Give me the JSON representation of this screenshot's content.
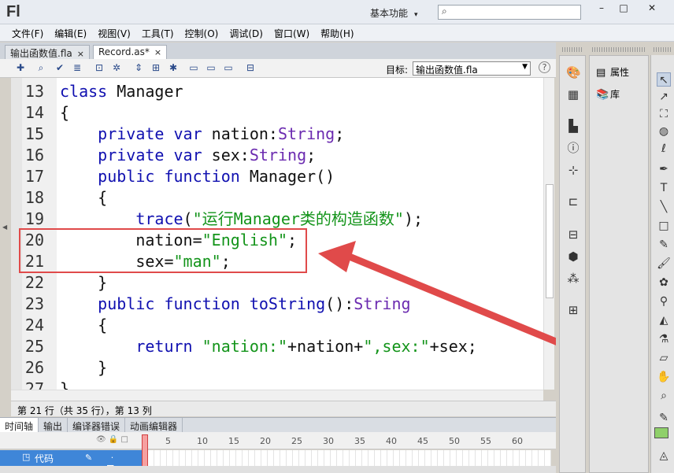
{
  "window": {
    "app_logo": "Fl",
    "workspace_label": "基本功能",
    "workspace_caret": "▾",
    "search_placeholder": "",
    "search_icon": "search-icon",
    "buttons": {
      "minimize": "–",
      "maximize": "□",
      "close": "✕"
    }
  },
  "menu": [
    "文件(F)",
    "编辑(E)",
    "视图(V)",
    "工具(T)",
    "控制(O)",
    "调试(D)",
    "窗口(W)",
    "帮助(H)"
  ],
  "tabs": [
    {
      "label": "输出函数值.fla",
      "close": "×",
      "active": false
    },
    {
      "label": "Record.as*",
      "close": "×",
      "active": true
    }
  ],
  "toolbar": {
    "icons": [
      "add-statement-icon",
      "find-icon",
      "check-syntax-icon",
      "auto-format-icon",
      "code-hint-icon",
      "debug-options-icon",
      "collapse-between-icon",
      "collapse-selection-icon",
      "expand-all-icon",
      "apply-block-comment-icon",
      "apply-line-comment-icon",
      "remove-comment-icon",
      "show-hide-toolbox-icon",
      "code-snippets-icon"
    ],
    "target_label": "目标:",
    "target_value": "输出函数值.fla",
    "help": "?"
  },
  "code_lines": [
    {
      "n": "13",
      "html": "<span class=\"kw\">class</span> Manager"
    },
    {
      "n": "14",
      "html": "{"
    },
    {
      "n": "15",
      "html": "    <span class=\"kw\">private</span> <span class=\"kw\">var</span> nation:<span class=\"ty\">String</span>;"
    },
    {
      "n": "16",
      "html": "    <span class=\"kw\">private</span> <span class=\"kw\">var</span> sex:<span class=\"ty\">String</span>;"
    },
    {
      "n": "17",
      "html": "    <span class=\"kw\">public</span> <span class=\"kw\">function</span> Manager()"
    },
    {
      "n": "18",
      "html": "    {"
    },
    {
      "n": "19",
      "html": "        <span class=\"fn\">trace</span>(<span class=\"str\">\"运行Manager类的构造函数\"</span>);"
    },
    {
      "n": "20",
      "html": "        nation=<span class=\"str\">\"English\"</span>;"
    },
    {
      "n": "21",
      "html": "        sex=<span class=\"str\">\"man\"</span>;"
    },
    {
      "n": "22",
      "html": "    }"
    },
    {
      "n": "23",
      "html": "    <span class=\"kw\">public</span> <span class=\"kw\">function</span> <span class=\"fn\">toString</span>():<span class=\"ty\">String</span>"
    },
    {
      "n": "24",
      "html": "    {"
    },
    {
      "n": "25",
      "html": "        <span class=\"kw\">return</span> <span class=\"str\">\"nation:\"</span>+nation+<span class=\"str\">\",sex:\"</span>+sex;"
    },
    {
      "n": "26",
      "html": "    }"
    },
    {
      "n": "27",
      "html": "}"
    }
  ],
  "status": "第 21 行（共 35 行），第 13 列",
  "timeline": {
    "tabs": [
      "时间轴",
      "输出",
      "编译器错误",
      "动画编辑器"
    ],
    "header_icons": "👁 🔒 □",
    "ticks": [
      "1",
      "5",
      "10",
      "15",
      "20",
      "25",
      "30",
      "35",
      "40",
      "45",
      "50",
      "55",
      "60"
    ],
    "layer_name": "代码",
    "layer_marks": "✎ · · ■"
  },
  "panels": {
    "dock_icons": [
      "color-icon",
      "swatches-icon",
      "align-icon",
      "info-icon",
      "transform-icon",
      "components-icon",
      "code-snippets-panel-icon",
      "3d-icon",
      "motion-presets-icon",
      "project-icon"
    ],
    "properties_label": "属性",
    "library_label": "库"
  },
  "tools": [
    "selection-tool",
    "subselection-tool",
    "free-transform-tool",
    "3d-rotation-tool",
    "lasso-tool",
    "pen-tool",
    "text-tool",
    "line-tool",
    "rectangle-tool",
    "pencil-tool",
    "brush-tool",
    "deco-tool",
    "bone-tool",
    "paint-bucket-tool",
    "eyedropper-tool",
    "eraser-tool",
    "hand-tool",
    "zoom-tool",
    "stroke-color-tool",
    "fill-color-tool"
  ],
  "colors": {
    "highlight": "#e04a4a",
    "fill_swatch": "#8fd06a"
  }
}
